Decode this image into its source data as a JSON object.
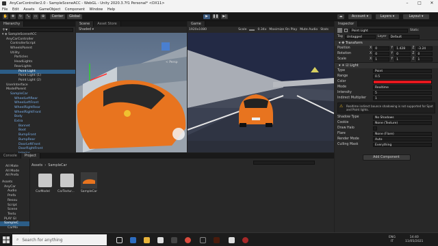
{
  "window": {
    "title": "AnyCarController2.0 - SampleSceneACC - WebGL - Unity 2020.3.7f1 Personal* <DX11>"
  },
  "menu": [
    "File",
    "Edit",
    "Assets",
    "GameObject",
    "Component",
    "Window",
    "Help"
  ],
  "toolbar": {
    "pivot": "Center",
    "space": "Global",
    "account": "Account",
    "layers": "Layers",
    "layout": "Layout"
  },
  "hierarchy": {
    "tab": "Hierarchy",
    "items": [
      {
        "label": "AnyCarController",
        "indent": 1,
        "blue": false,
        "sel": false
      },
      {
        "label": "ControllerScript",
        "indent": 2,
        "blue": false,
        "sel": false
      },
      {
        "label": "WheelsParent",
        "indent": 2,
        "blue": false,
        "sel": false
      },
      {
        "label": "Utility",
        "indent": 2,
        "blue": false,
        "sel": false
      },
      {
        "label": "Particles",
        "indent": 3,
        "blue": false,
        "sel": false
      },
      {
        "label": "HeadLights",
        "indent": 3,
        "blue": false,
        "sel": false
      },
      {
        "label": "RearLights",
        "indent": 3,
        "blue": false,
        "sel": false
      },
      {
        "label": "Point Light",
        "indent": 4,
        "blue": false,
        "sel": true
      },
      {
        "label": "Point Light (1)",
        "indent": 4,
        "blue": false,
        "sel": false
      },
      {
        "label": "Point Light (2)",
        "indent": 4,
        "blue": false,
        "sel": false
      },
      {
        "label": "UserInterface",
        "indent": 1,
        "blue": false,
        "sel": false
      },
      {
        "label": "ModelParent",
        "indent": 1,
        "blue": false,
        "sel": false
      },
      {
        "label": "SampleCar",
        "indent": 2,
        "blue": true,
        "sel": false
      },
      {
        "label": "WheelLeftRear",
        "indent": 3,
        "blue": true,
        "sel": false
      },
      {
        "label": "WheelLeftFront",
        "indent": 3,
        "blue": true,
        "sel": false
      },
      {
        "label": "WheelRightRear",
        "indent": 3,
        "blue": true,
        "sel": false
      },
      {
        "label": "WheelRightFront",
        "indent": 3,
        "blue": true,
        "sel": false
      },
      {
        "label": "Body",
        "indent": 3,
        "blue": true,
        "sel": false
      },
      {
        "label": "Extra",
        "indent": 3,
        "blue": true,
        "sel": false
      },
      {
        "label": "Bonnet",
        "indent": 4,
        "blue": true,
        "sel": false
      },
      {
        "label": "Boot",
        "indent": 4,
        "blue": true,
        "sel": false
      },
      {
        "label": "BumpFront",
        "indent": 4,
        "blue": true,
        "sel": false
      },
      {
        "label": "BumpRear",
        "indent": 4,
        "blue": true,
        "sel": false
      },
      {
        "label": "DoorLeftFront",
        "indent": 4,
        "blue": true,
        "sel": false
      },
      {
        "label": "DoorRightFront",
        "indent": 4,
        "blue": true,
        "sel": false
      },
      {
        "label": "Interior",
        "indent": 4,
        "blue": true,
        "sel": false
      }
    ]
  },
  "scene": {
    "tab": "Scene",
    "tab2": "Asset Store",
    "shading": "Shaded",
    "persp": "< Persp"
  },
  "game": {
    "tab": "Game",
    "resolution": "1920x1080",
    "scale_label": "Scale",
    "scale_value": "0.34x",
    "maximize": "Maximize On Play",
    "mute": "Mute Audio",
    "stats": "Stats"
  },
  "project": {
    "tab": "Console",
    "tab2": "Project",
    "breadcrumb": [
      "Assets",
      "SampleCar"
    ],
    "favorites": [
      "All Mate",
      "All Mode",
      "All Prefa"
    ],
    "tree": [
      "Assets",
      "AnyCar",
      "Audio",
      "Prefa",
      "Resou",
      "Script",
      "Scene",
      "Textu",
      "PLAY GI",
      "SampleC",
      "CarMo"
    ],
    "files": [
      {
        "label": "CarModel",
        "kind": "folder"
      },
      {
        "label": "CarTextur...",
        "kind": "folder"
      },
      {
        "label": "SampleCar",
        "kind": "prefab"
      }
    ]
  },
  "inspector": {
    "tab": "Inspector",
    "object_name": "Point Light",
    "static_label": "Static",
    "tag_label": "Tag",
    "tag_value": "Untagged",
    "layer_label": "Layer",
    "layer_value": "Default",
    "transform": {
      "header": "Transform",
      "position": {
        "label": "Position",
        "x": "0",
        "y": "1.428",
        "z": "-3.24"
      },
      "rotation": {
        "label": "Rotation",
        "x": "0",
        "y": "0",
        "z": "0"
      },
      "scale": {
        "label": "Scale",
        "x": "1",
        "y": "1",
        "z": "1"
      }
    },
    "light": {
      "header": "Light",
      "type": {
        "label": "Type",
        "value": "Point"
      },
      "range": {
        "label": "Range",
        "value": "0.5"
      },
      "color": {
        "label": "Color",
        "value": "#e8181e"
      },
      "mode": {
        "label": "Mode",
        "value": "Realtime"
      },
      "intensity": {
        "label": "Intensity",
        "value": "5"
      },
      "indirect": {
        "label": "Indirect Multiplier",
        "value": "1"
      },
      "warning": "Realtime indirect bounce shadowing is not supported for Spot and Point lights.",
      "shadow": {
        "label": "Shadow Type",
        "value": "No Shadows"
      },
      "cookie": {
        "label": "Cookie",
        "value": "None (Texture)"
      },
      "halo": {
        "label": "Draw Halo",
        "value": ""
      },
      "flare": {
        "label": "Flare",
        "value": "None (Flare)"
      },
      "render": {
        "label": "Render Mode",
        "value": "Auto"
      },
      "culling": {
        "label": "Culling Mask",
        "value": "Everything"
      }
    },
    "add_component": "Add Component"
  },
  "taskbar": {
    "search_placeholder": "Search for anything",
    "lang": "ENG",
    "region": "IT",
    "time": "14:40",
    "date": "11/05/2021"
  },
  "colors": {
    "selection": "#2c5d87",
    "car": "#e8741f",
    "accent_blue": "#7ab0ec"
  }
}
